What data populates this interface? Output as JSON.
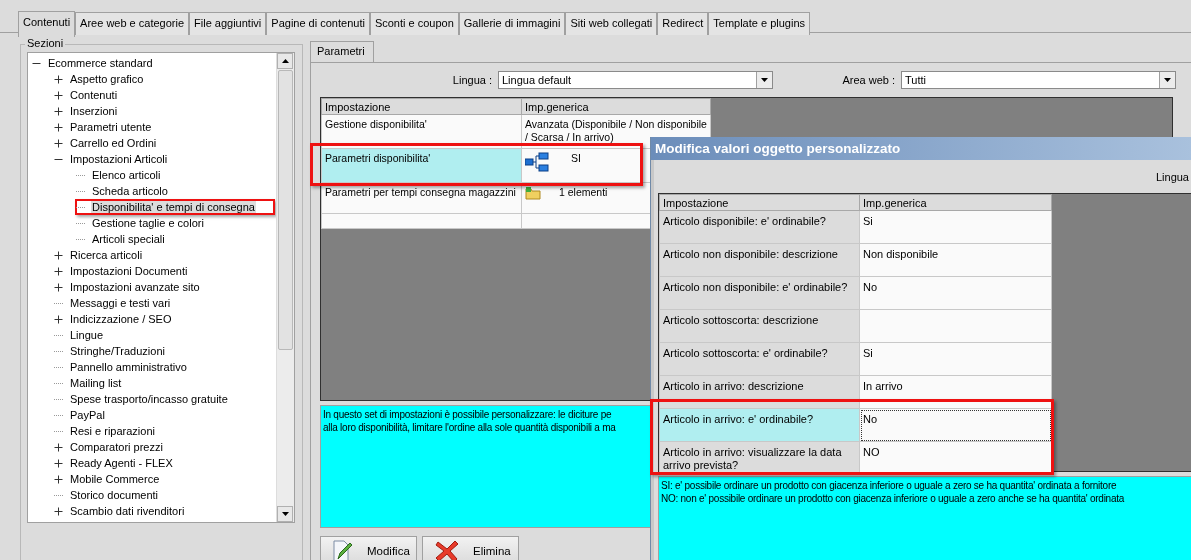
{
  "tabs": [
    {
      "label": "Contenuti",
      "selected": true
    },
    {
      "label": "Aree web e categorie",
      "selected": false
    },
    {
      "label": "File aggiuntivi",
      "selected": false
    },
    {
      "label": "Pagine di contenuti",
      "selected": false
    },
    {
      "label": "Sconti e coupon",
      "selected": false
    },
    {
      "label": "Gallerie di immagini",
      "selected": false
    },
    {
      "label": "Siti web collegati",
      "selected": false
    },
    {
      "label": "Redirect",
      "selected": false
    },
    {
      "label": "Template e plugins",
      "selected": false
    }
  ],
  "sections": {
    "title": "Sezioni",
    "tree": [
      {
        "label": "Ecommerce standard",
        "kind": "expanded",
        "selected": false,
        "children": [
          {
            "label": "Aspetto grafico",
            "kind": "collapsed",
            "selected": false
          },
          {
            "label": "Contenuti",
            "kind": "collapsed",
            "selected": false
          },
          {
            "label": "Inserzioni",
            "kind": "collapsed",
            "selected": false
          },
          {
            "label": "Parametri utente",
            "kind": "collapsed",
            "selected": false
          },
          {
            "label": "Carrello ed Ordini",
            "kind": "collapsed",
            "selected": false
          },
          {
            "label": "Impostazioni Articoli",
            "kind": "expanded",
            "selected": false,
            "children": [
              {
                "label": "Elenco articoli",
                "kind": "leaf",
                "selected": false
              },
              {
                "label": "Scheda articolo",
                "kind": "leaf",
                "selected": false
              },
              {
                "label": "Disponibilita' e tempi di consegna",
                "kind": "leaf",
                "selected": true
              },
              {
                "label": "Gestione taglie e colori",
                "kind": "leaf",
                "selected": false
              },
              {
                "label": "Articoli speciali",
                "kind": "leaf",
                "selected": false
              }
            ]
          },
          {
            "label": "Ricerca articoli",
            "kind": "collapsed",
            "selected": false
          },
          {
            "label": "Impostazioni Documenti",
            "kind": "collapsed",
            "selected": false
          },
          {
            "label": "Impostazioni avanzate sito",
            "kind": "collapsed",
            "selected": false
          },
          {
            "label": "Messaggi e testi vari",
            "kind": "leaf",
            "selected": false
          },
          {
            "label": "Indicizzazione / SEO",
            "kind": "collapsed",
            "selected": false
          },
          {
            "label": "Lingue",
            "kind": "leaf",
            "selected": false
          },
          {
            "label": "Stringhe/Traduzioni",
            "kind": "leaf",
            "selected": false
          },
          {
            "label": "Pannello amministrativo",
            "kind": "leaf",
            "selected": false
          },
          {
            "label": "Mailing list",
            "kind": "leaf",
            "selected": false
          },
          {
            "label": "Spese trasporto/incasso gratuite",
            "kind": "leaf",
            "selected": false
          },
          {
            "label": "PayPal",
            "kind": "leaf",
            "selected": false
          },
          {
            "label": "Resi e riparazioni",
            "kind": "leaf",
            "selected": false
          },
          {
            "label": "Comparatori prezzi",
            "kind": "collapsed",
            "selected": false
          },
          {
            "label": "Ready Agenti - FLEX",
            "kind": "collapsed",
            "selected": false
          },
          {
            "label": "Mobile Commerce",
            "kind": "collapsed",
            "selected": false
          },
          {
            "label": "Storico documenti",
            "kind": "leaf",
            "selected": false
          },
          {
            "label": "Scambio dati rivenditori",
            "kind": "collapsed",
            "selected": false
          }
        ]
      }
    ]
  },
  "panel": {
    "tab": "Parametri",
    "language": {
      "label": "Lingua :",
      "value": "Lingua default"
    },
    "web_area": {
      "label": "Area web :",
      "value": "Tutti"
    },
    "grid": {
      "columns": [
        "Impostazione",
        "Imp.generica"
      ],
      "rows": [
        {
          "setting": "Gestione disponibilita'",
          "value": "Avanzata (Disponibile / Non disponibile / Scarsa / In arrivo)",
          "kind": "text",
          "selected": false
        },
        {
          "setting": "Parametri disponibilita'",
          "value": "SI",
          "kind": "tree",
          "selected": true
        },
        {
          "setting": "Parametri per tempi consegna magazzini",
          "value": "1 elementi",
          "kind": "list",
          "selected": false
        },
        {
          "kind": "empty",
          "selected": false
        }
      ]
    },
    "description": [
      "In questo set di impostazioni è possibile personalizzare: le diciture pe",
      "alla loro disponibilità, limitare l'ordine alla sole quantità disponibili a ma"
    ],
    "buttons": [
      {
        "label": "Modifica",
        "kind": "edit"
      },
      {
        "label": "Elimina",
        "kind": "delete"
      }
    ]
  },
  "dialog": {
    "title": "Modifica valori oggetto personalizzato",
    "language_label": "Lingua",
    "grid": {
      "columns": [
        "Impostazione",
        "Imp.generica"
      ],
      "rows": [
        {
          "setting": "Articolo disponibile: e' ordinabile?",
          "value": "Si",
          "selected": false
        },
        {
          "setting": "Articolo non disponibile: descrizione",
          "value": "Non disponibile",
          "selected": false
        },
        {
          "setting": "Articolo non disponibile: e' ordinabile?",
          "value": "No",
          "selected": false
        },
        {
          "setting": "Articolo sottoscorta: descrizione",
          "selected": false
        },
        {
          "setting": "Articolo sottoscorta: e' ordinabile?",
          "value": "Si",
          "selected": false
        },
        {
          "setting": "Articolo in arrivo: descrizione",
          "value": "In arrivo",
          "selected": false
        },
        {
          "setting": "Articolo in arrivo: e' ordinabile?",
          "value": "No",
          "selected": true
        },
        {
          "setting": "Articolo in arrivo: visualizzare la data arrivo prevista?",
          "value": "NO",
          "selected": false
        }
      ]
    },
    "description": [
      "SI: e' possibile ordinare un prodotto con giacenza inferiore o uguale a zero se ha quantita' ordinata a fornitore",
      "NO: non e' possibile ordinare un prodotto con giacenza inferiore o uguale a zero anche se ha quantita' ordinata"
    ]
  }
}
